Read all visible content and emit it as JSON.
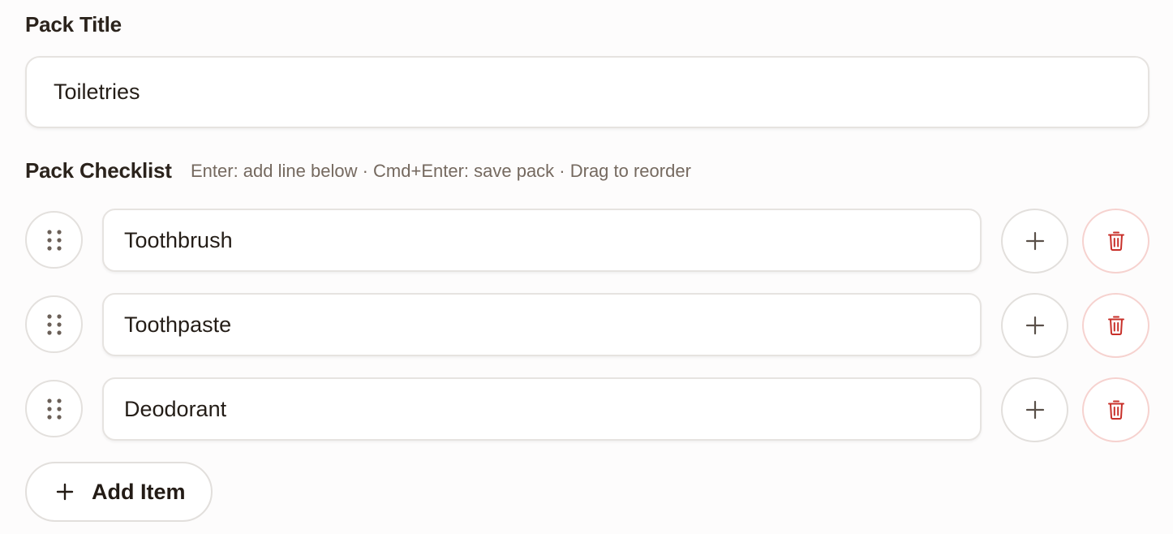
{
  "pack_title": {
    "label": "Pack Title",
    "value": "Toiletries"
  },
  "checklist": {
    "label": "Pack Checklist",
    "hint": "Enter: add line below · Cmd+Enter: save pack · Drag to reorder",
    "items": [
      {
        "value": "Toothbrush"
      },
      {
        "value": "Toothpaste"
      },
      {
        "value": "Deodorant"
      }
    ]
  },
  "add_item": {
    "label": "Add Item"
  },
  "icons": {
    "drag": "drag-handle-icon",
    "add": "plus-icon",
    "delete": "trash-icon",
    "add_item": "plus-icon"
  },
  "colors": {
    "text": "#221c17",
    "hint": "#75695f",
    "border": "#e6e3e0",
    "delete_accent": "#c8302a",
    "delete_border": "#f6d2cf",
    "icon_muted": "#6b6058"
  }
}
